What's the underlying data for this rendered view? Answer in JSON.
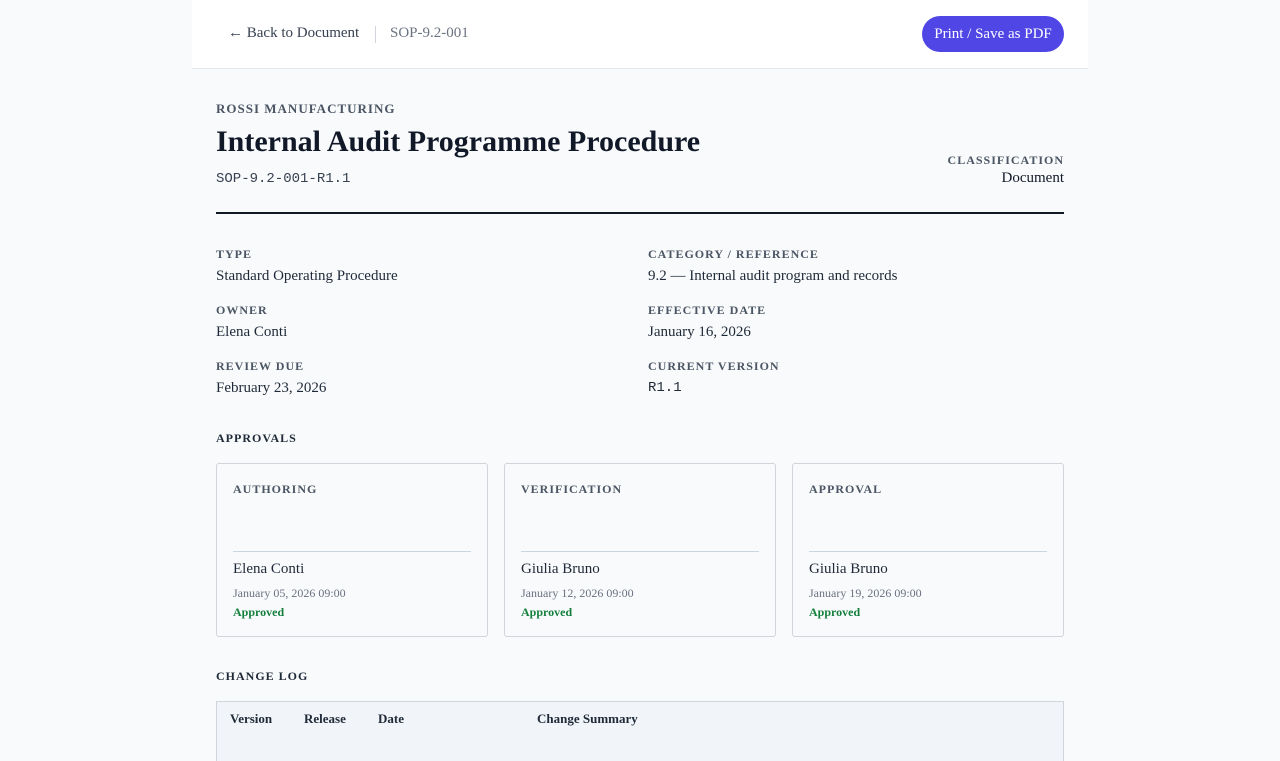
{
  "toolbar": {
    "back_label": "← Back to Document",
    "doc_id": "SOP-9.2-001",
    "print_label": "Print / Save as PDF",
    "accent": "#4f46e5"
  },
  "header": {
    "company": "ROSSI MANUFACTURING",
    "title": "Internal Audit Programme Procedure",
    "code": "SOP-9.2-001-R1.1",
    "classification_label": "CLASSIFICATION",
    "classification_value": "Document"
  },
  "meta": {
    "type": {
      "label": "TYPE",
      "value": "Standard Operating Procedure"
    },
    "category": {
      "label": "CATEGORY / REFERENCE",
      "value": "9.2 — Internal audit program and records"
    },
    "owner": {
      "label": "OWNER",
      "value": "Elena Conti"
    },
    "effective": {
      "label": "EFFECTIVE DATE",
      "value": "January 16, 2026"
    },
    "review": {
      "label": "REVIEW DUE",
      "value": "February 23, 2026"
    },
    "version": {
      "label": "CURRENT VERSION",
      "value": "R1.1"
    }
  },
  "approvals": {
    "title": "APPROVALS",
    "status_color": "#15803d",
    "cards": [
      {
        "stage": "AUTHORING",
        "name": "Elena Conti",
        "date": "January 05, 2026 09:00",
        "status": "Approved"
      },
      {
        "stage": "VERIFICATION",
        "name": "Giulia Bruno",
        "date": "January 12, 2026 09:00",
        "status": "Approved"
      },
      {
        "stage": "APPROVAL",
        "name": "Giulia Bruno",
        "date": "January 19, 2026 09:00",
        "status": "Approved"
      }
    ]
  },
  "changelog": {
    "title": "CHANGE LOG",
    "columns": [
      "Version",
      "Release",
      "Date",
      "Change Summary"
    ]
  }
}
